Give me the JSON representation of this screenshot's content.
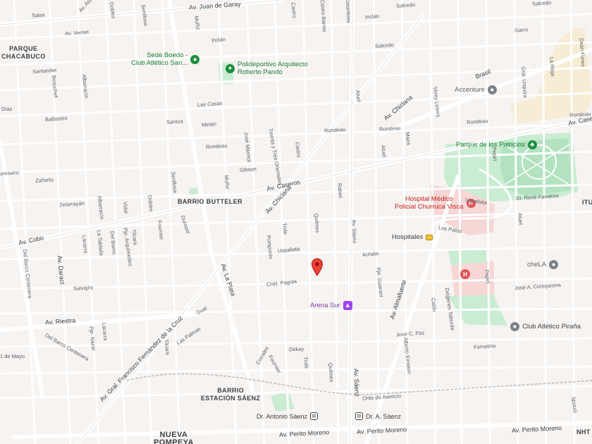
{
  "map": {
    "areas": {
      "parque_chacabuco": "PARQUE\nCHACABUCO",
      "barrio_butteler": "BARRIO BUTTELER",
      "barrio_estacion_saenz": "BARRIO\nESTACIÓN SÁENZ",
      "nueva_pompeya": "NUEVA\nPOMPEYA",
      "edge_right_top": "ITU",
      "edge_right_bottom": "NHT"
    },
    "pois": {
      "sede_boedo": "Sede Boedo -\nClub Atlético San...",
      "polideportivo": "Polideportivo Arquitecto\nRoberto Pando",
      "accenture": "Accenture",
      "parque_patricios": "Parque de los Patricios",
      "hospital_churruca": "Hospital Médico\nPolicial Churruca Visca",
      "hospitales": "Hospitales",
      "chela": "cheLA",
      "arena_sur": "Arena Sur",
      "club_pirana": "Club Atlético Piraña"
    },
    "transit": {
      "dr_antonio_saenz": "Dr. Antonio Sáenz",
      "dr_a_saenz": "Dr. A. Sáenz"
    },
    "streets": {
      "av_juan_de_garay": "Av. Juan de Garay",
      "av_asamblea": "Av. Asam",
      "salas": "Salas",
      "av_vernet": "Av. Vernet",
      "dobles": "Dobles",
      "sanabria": "Senillosa",
      "muniz_top": "Muñiz",
      "castro_top": "Castro",
      "castro_barros": "Castro Barros",
      "colombres": "Colombres",
      "inclan_1": "Inclán",
      "inclan_2": "Inclán",
      "salcedo_1": "Salcedo",
      "salcedo_2": "Salcedo",
      "salcedo_3": "Salcedo",
      "garro": "Garro",
      "deanfunes": "Deán Funes",
      "la_rioja": "La Rioja",
      "brasil": "Brasil",
      "av_chiclana_top": "Av. Chiclana",
      "santander": "Santander",
      "beauchef": "Beauchef",
      "albarracin": "Albarracín",
      "las_casas": "Las Casas",
      "atuel_top": "Atuel",
      "virrey_liniers": "Virrey Liniers",
      "gral_urquiza": "Gral. Urquiza",
      "diaz": "Díaz",
      "balbastro": "Balbastro",
      "saraza": "Saraza",
      "metan": "Metán",
      "rondeau_1": "Rondeau",
      "rondeau_2": "Rondeau",
      "rondeau_3": "Rondeau",
      "rondeau_4": "Rondeau",
      "rondeau_5": "Rondeau",
      "jose_marmol": "José Mármol",
      "treinta_y_tres": "Treinta y Tres Orientales",
      "castro_mid": "Castro",
      "atuel_mid": "Atuel",
      "maza": "Maza",
      "gibson": "Gibson",
      "av_caseros": "Av. Caseros",
      "av_caseros_right": "Av. Caser",
      "pepiri_top": "Pepirí",
      "moreno": "oresano",
      "zanartu": "Zañartu",
      "senillosa_mid": "Senillosa",
      "muniz_mid": "Muñiz",
      "rabiel": "Rabiel",
      "uspallata_right": "Uspallata",
      "dr_rene_favaloro": "Dr. René Favaloro",
      "zelarrayan": "Zelarrayán",
      "albarracin_mid": "Albarracín",
      "vidal": "Vidal",
      "dobles_mid": "Dobles",
      "av_chiclana_mid": "Av. Chiclana",
      "trole": "Trole",
      "quilmes_mid": "Quilmes",
      "av_saenz_mid": "Av. Sáenz",
      "los_patos": "Los Patos",
      "atuel_right": "Atuel",
      "av_cobo": "Av. Cobo",
      "del_barco_centenera": "Del Barco Centenera",
      "la_tablada": "La Tablada",
      "lacarra": "Lacarra",
      "del_barrio": "Del Barrio",
      "pje_arquimedes": "Pje. Arquímedes",
      "tilcara": "Tilcara",
      "fournier": "Fournier",
      "dumont": "Dumont",
      "av_la_plata": "Av. La Plata",
      "pomponio": "Pomponio",
      "uspallata_mid": "Uspallata",
      "achala": "Achala",
      "av_daract": "Av. Daract",
      "salvigny": "Salvigny",
      "cnel_pagola": "Cnel. Pagola",
      "pje_guaraní": "Pje. Guaraní",
      "av_almafuerte": "Av. Almafuerte",
      "caldo": "Caldo",
      "diogenes_taborda": "Diógenes Taborda",
      "pepiri_mid": "Pepirí",
      "jose_cortejarena": "José A. Cortejarena",
      "av_riestra": "Av. Riestra",
      "av_gral_fernandez_de_la_cruz": "Av. Gral. Francisco Fernández de la Cruz",
      "gual": "Gual",
      "las_palmas": "Las Palmas",
      "lacarra_low": "Lacarra",
      "pje_nazar": "Pje. Nazar",
      "del_barco_low": "Del Barco Centenera",
      "primero_de_mayo": "1 de Mayo",
      "tilcara_low": "Tilcara",
      "dekay": "Dekay",
      "corrales": "Corrales",
      "fournier_low": "Fournier",
      "trole_low": "Trole",
      "quilmes_low": "Quilmes",
      "av_saenz_low": "Av. Sáenz",
      "jose_c_paz": "José C. Paz",
      "alberto_einstein": "Alberto Einstein",
      "famatina": "Famatina",
      "orito_de_asencio": "Orito de Asencio",
      "av_perito_moreno_1": "Av. Perito Moreno",
      "av_perito_moreno_2": "Av. Perito Moreno",
      "av_perito_moreno_3": "Av. Perito Moreno",
      "iguazu": "Iguazú"
    }
  }
}
